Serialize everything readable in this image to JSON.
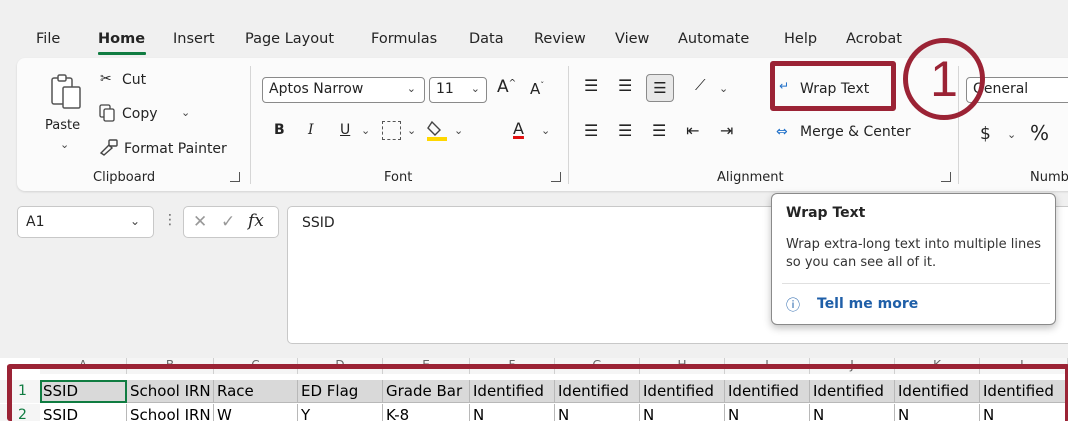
{
  "tabs": [
    "File",
    "Home",
    "Insert",
    "Page Layout",
    "Formulas",
    "Data",
    "Review",
    "View",
    "Automate",
    "Help",
    "Acrobat"
  ],
  "clipboard": {
    "paste": "Paste",
    "cut": "Cut",
    "copy": "Copy",
    "format_painter": "Format Painter",
    "group_label": "Clipboard"
  },
  "font": {
    "name": "Aptos Narrow",
    "size": "11",
    "bold": "B",
    "italic": "I",
    "underline": "U",
    "font_color_glyph": "A",
    "group_label": "Font"
  },
  "alignment": {
    "wrap_text": "Wrap Text",
    "merge_center": "Merge & Center",
    "group_label": "Alignment"
  },
  "number": {
    "format": "General",
    "currency_glyph": "$",
    "percent_glyph": "%",
    "group_label": "Numb"
  },
  "callout": {
    "number": "1",
    "color": "#9b2335"
  },
  "formula_bar": {
    "name_box": "A1",
    "fx_glyph": "fx",
    "content": "SSID"
  },
  "tooltip": {
    "title": "Wrap Text",
    "description": "Wrap extra-long text into multiple lines so you can see all of it.",
    "link": "Tell me more"
  },
  "sheet": {
    "columns": [
      "A",
      "B",
      "C",
      "D",
      "E",
      "F",
      "G",
      "H",
      "I",
      "J",
      "K",
      "L"
    ],
    "row1": [
      "SSID",
      "School IRN",
      "Race",
      "ED Flag",
      "Grade Bar",
      "Identified",
      "Identified",
      "Identified",
      "Identified",
      "Identified",
      "Identified",
      "Identified"
    ],
    "row2": [
      "SSID",
      "School IRN",
      "W",
      "Y",
      "K-8",
      "N",
      "N",
      "N",
      "N",
      "N",
      "N",
      "N"
    ],
    "row_numbers": [
      "1",
      "2"
    ]
  }
}
